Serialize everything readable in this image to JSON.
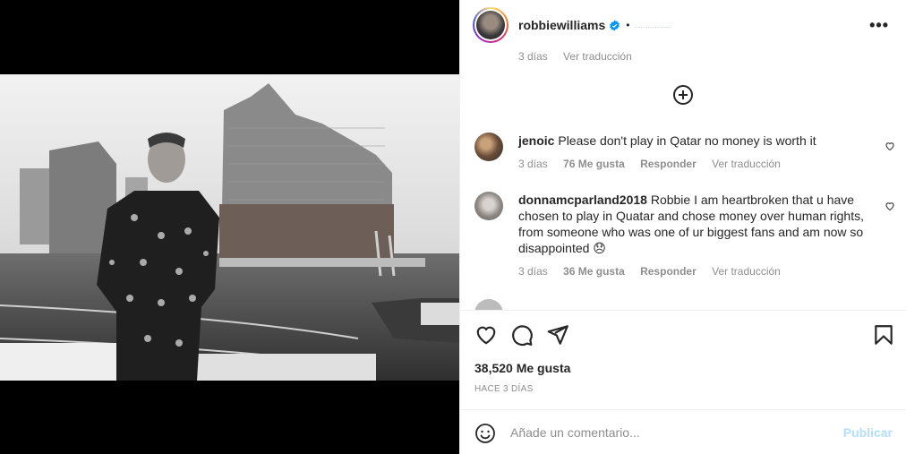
{
  "post": {
    "username": "robbiewilliams",
    "separator": "•",
    "verified_icon": "verified-badge-icon",
    "more_icon": "more-options-icon"
  },
  "previous_comment_meta": {
    "time": "3 días",
    "translate": "Ver traducción"
  },
  "comments": [
    {
      "username": "jenoic",
      "text": "Please don't play in Qatar no money is worth it",
      "time": "3 días",
      "likes": "76 Me gusta",
      "reply": "Responder",
      "translate": "Ver traducción"
    },
    {
      "username": "donnamcparland2018",
      "text": "Robbie I am heartbroken that u have chosen to play in Quatar and chose money over human rights, from someone who was one of ur biggest fans and am now so disappointed 😞",
      "time": "3 días",
      "likes": "36 Me gusta",
      "reply": "Responder",
      "translate": "Ver traducción"
    }
  ],
  "actions": {
    "like_icon": "heart-icon",
    "comment_icon": "comment-icon",
    "share_icon": "send-icon",
    "save_icon": "bookmark-icon"
  },
  "likes_count": "38,520 Me gusta",
  "posted_ago": "HACE 3 DÍAS",
  "composer": {
    "emoji_icon": "emoji-icon",
    "placeholder": "Añade un comentario...",
    "publish_label": "Publicar"
  },
  "colors": {
    "text": "#262626",
    "muted": "#8e8e8e",
    "publish_disabled": "#b2dffc",
    "verified": "#0095f6"
  }
}
